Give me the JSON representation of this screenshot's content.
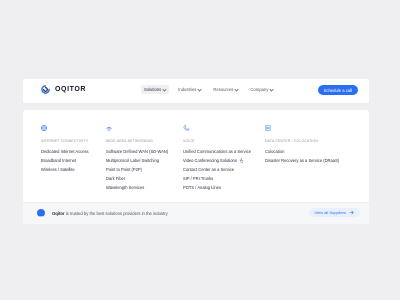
{
  "brand": {
    "name": "OQITOR",
    "accent_color": "#2a6ff2"
  },
  "nav": {
    "items": [
      {
        "label": "Solutions",
        "active": true
      },
      {
        "label": "Industries",
        "active": false
      },
      {
        "label": "Resources",
        "active": false
      },
      {
        "label": "Company",
        "active": false
      }
    ],
    "cta_label": "Schedule a call"
  },
  "menu": {
    "columns": [
      {
        "icon": "globe-icon",
        "title": "INTERNET CONNECTIVITY",
        "links": [
          "Dedicated Internet Access",
          "Broadband Internet",
          "Wireless / Satellite"
        ]
      },
      {
        "icon": "network-icon",
        "title": "WIDE AREA NETWORKING",
        "links": [
          "Software Defined WAN (SD-WAN)",
          "Multiprotocol Label Switching",
          "Point to Point (P2P)",
          "Dark Fiber",
          "Wavelength Services"
        ]
      },
      {
        "icon": "phone-icon",
        "title": "VOICE",
        "links": [
          "Unified Communications as a Service",
          "Video Conferencing Solutions",
          "Contact Center as a Service",
          "SIP / PRI Trunks",
          "POTS / Analog Lines"
        ]
      },
      {
        "icon": "server-icon",
        "title": "DATA CENTER / COLOCATION",
        "links": [
          "Colocation",
          "Disaster Recovery as a Service (DRaaS)"
        ]
      }
    ]
  },
  "footer": {
    "icon": "diamond-icon",
    "brand": "Oqitor",
    "text": " is trusted by the best solutions providers in the industry",
    "button_label": "View all Suppliers"
  }
}
